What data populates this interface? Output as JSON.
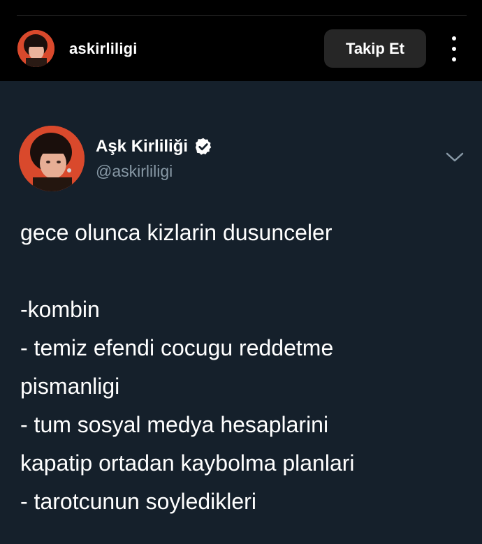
{
  "header": {
    "username": "askirliligi",
    "follow_label": "Takip Et",
    "more_icon": "more-vertical-icon"
  },
  "tweet": {
    "display_name": "Aşk Kirliliği",
    "handle": "@askirliligi",
    "verified": true,
    "lines": [
      "gece olunca kizlarin dusunceler",
      "",
      "-kombin",
      "- temiz efendi cocugu reddetme",
      "pismanligi",
      "- tum sosyal medya hesaplarini",
      "kapatip ortadan kaybolma planlari",
      "- tarotcunun soyledikleri"
    ]
  },
  "colors": {
    "header_bg": "#000000",
    "tweet_bg": "#15202b",
    "secondary_text": "#8899a6",
    "button_bg": "#262626",
    "avatar_accent": "#d9492c"
  }
}
